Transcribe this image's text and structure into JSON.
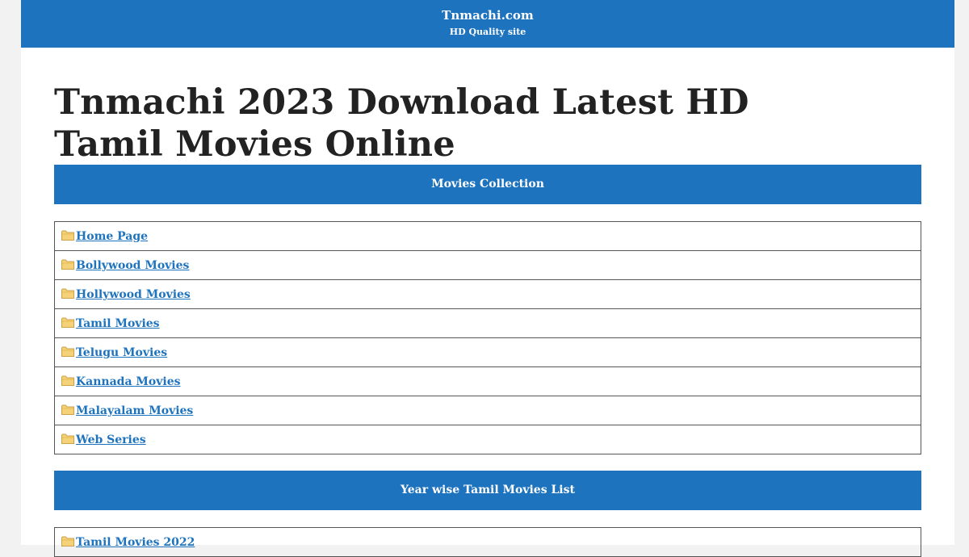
{
  "header": {
    "site_name": "Tnmachi.com",
    "tagline": "HD Quality site"
  },
  "main": {
    "title": "Tnmachi 2023 Download Latest HD Tamil Movies Online",
    "sections": [
      {
        "heading": "Movies Collection",
        "links": [
          "Home Page",
          "Bollywood Movies",
          "Hollywood Movies",
          "Tamil Movies",
          "Telugu Movies",
          "Kannada Movies",
          "Malayalam Movies",
          "Web Series"
        ]
      },
      {
        "heading": "Year wise Tamil Movies List",
        "links": [
          "Tamil Movies 2022"
        ]
      }
    ]
  },
  "colors": {
    "header_bg": "#1e73be",
    "link": "#1e73be",
    "title": "#222222",
    "page_bg": "#f2f2f2"
  },
  "icons": {
    "link_icon": "folder-icon"
  }
}
